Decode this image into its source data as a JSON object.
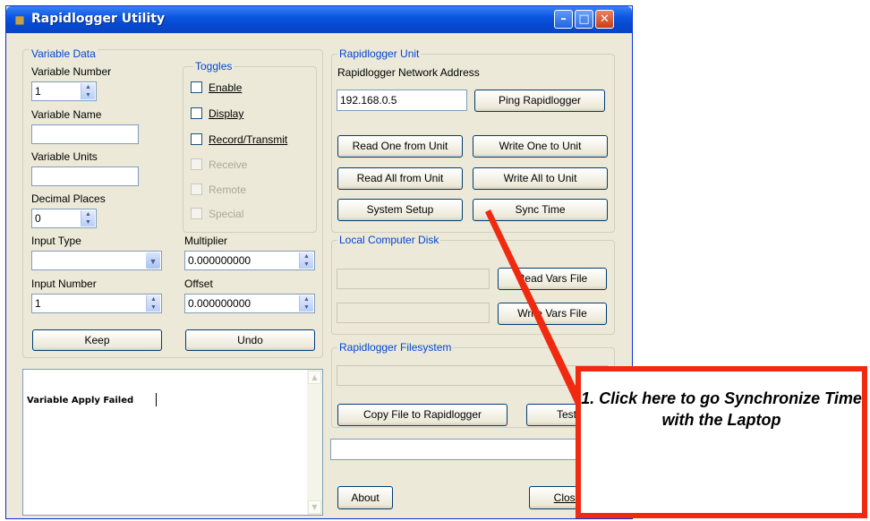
{
  "window": {
    "title": "Rapidlogger Utility",
    "app_icon": "folder-icon"
  },
  "variable_data": {
    "group_title": "Variable Data",
    "variable_number_label": "Variable Number",
    "variable_number_value": "1",
    "variable_name_label": "Variable Name",
    "variable_name_value": "",
    "variable_units_label": "Variable Units",
    "variable_units_value": "",
    "decimal_places_label": "Decimal Places",
    "decimal_places_value": "0",
    "input_type_label": "Input Type",
    "input_type_value": "",
    "input_number_label": "Input Number",
    "input_number_value": "1",
    "multiplier_label": "Multiplier",
    "multiplier_value": "0.000000000",
    "offset_label": "Offset",
    "offset_value": "0.000000000",
    "keep_button": "Keep",
    "undo_button": "Undo"
  },
  "toggles": {
    "group_title": "Toggles",
    "items": [
      {
        "label": "Enable",
        "enabled": true,
        "checked": false
      },
      {
        "label": "Display",
        "enabled": true,
        "checked": false
      },
      {
        "label": "Record/Transmit",
        "enabled": true,
        "checked": false
      },
      {
        "label": "Receive",
        "enabled": false,
        "checked": false
      },
      {
        "label": "Remote",
        "enabled": false,
        "checked": false
      },
      {
        "label": "Special",
        "enabled": false,
        "checked": false
      }
    ]
  },
  "log": {
    "text": "Variable Apply Failed"
  },
  "unit": {
    "group_title": "Rapidlogger Unit",
    "address_label": "Rapidlogger Network Address",
    "address_value": "192.168.0.5",
    "ping_button": "Ping Rapidlogger",
    "read_one_button": "Read One from Unit",
    "write_one_button": "Write One to Unit",
    "read_all_button": "Read All from Unit",
    "write_all_button": "Write All to Unit",
    "system_setup_button": "System Setup",
    "sync_time_button": "Sync Time"
  },
  "local_disk": {
    "group_title": "Local Computer Disk",
    "read_vars_button": "Read Vars File",
    "write_vars_button": "Write Vars File"
  },
  "filesystem": {
    "group_title": "Rapidlogger Filesystem",
    "copy_file_button": "Copy File to Rapidlogger",
    "test_button": "Test"
  },
  "bottom": {
    "about_button": "About",
    "close_button": "Close"
  },
  "annotation": {
    "text": "1. Click here to go Synchronize Time with the Laptop",
    "color": "#f02a10"
  }
}
